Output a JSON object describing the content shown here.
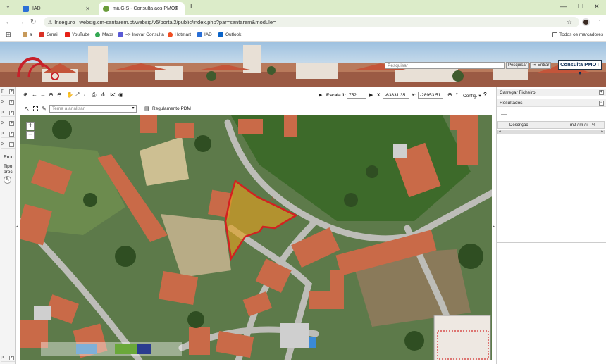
{
  "browser": {
    "tabs": [
      {
        "label": "IAD"
      },
      {
        "label": "miuGIS - Consulta aos PMOT"
      }
    ],
    "new_tab": "+",
    "window_controls": {
      "minimize": "—",
      "restore": "❐",
      "close": "✕"
    },
    "address": {
      "secure_label": "Inseguro",
      "url": "websig.cm-santarem.pt/websig/v5/portal2/public/index.php?par=santarem&module="
    },
    "bookmarks": [
      {
        "label": "a"
      },
      {
        "label": "Gmail"
      },
      {
        "label": "YouTube"
      },
      {
        "label": "Maps"
      },
      {
        "label": "=> Inovar Consulta"
      },
      {
        "label": "Hotmart"
      },
      {
        "label": "IAD"
      },
      {
        "label": "Outlook"
      }
    ],
    "all_bookmarks": "Todos os marcadores"
  },
  "header": {
    "search_placeholder": "Pesquisar",
    "search_button": "Pesquisar",
    "login_button": "Entrar",
    "module_button": "Consulta PMOT"
  },
  "left_panel": {
    "rows": [
      "T",
      "P",
      "P",
      "P",
      "P",
      "P"
    ],
    "proc_label": "Proc",
    "tipo_label": "Tipo",
    "proc2_label": "proc",
    "bottom_label": "P"
  },
  "toolbar": {
    "scale_label": "Escala 1:",
    "scale_value": "752",
    "x_label": "X:",
    "x_value": "-63831.35",
    "y_label": "Y:",
    "y_value": "-28953.51",
    "config_label": "Config.",
    "help": "?"
  },
  "toolbar2": {
    "theme_placeholder": "Tema a analisar",
    "regulamento_label": "Regulamento PDM"
  },
  "map": {
    "zoom_in": "+",
    "zoom_out": "−",
    "colors": {
      "parcel_fill": "#e0a020",
      "parcel_stroke": "#d42020",
      "road": "#bdbdb8",
      "roof": "#c96a48"
    }
  },
  "right_panel": {
    "load_file": "Carregar Ficheiro",
    "results": "Resultados",
    "dots": "----",
    "col_descricao": "Descrição",
    "col_units": "m2 / m / i",
    "col_pct": "%"
  }
}
